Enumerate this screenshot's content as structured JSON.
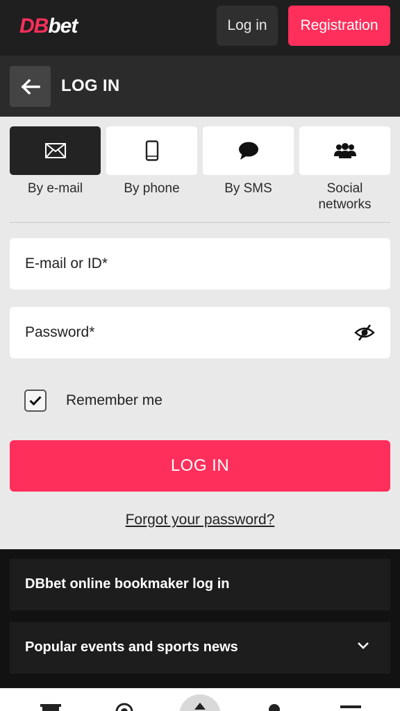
{
  "header": {
    "logo_red": "DB",
    "logo_white": "bet",
    "login_label": "Log in",
    "registration_label": "Registration",
    "brand_color": "#ff2f5b"
  },
  "titlebar": {
    "back_icon": "arrow-left-icon",
    "title": "LOG IN"
  },
  "tabs": [
    {
      "label": "By e-mail",
      "icon": "envelope-icon",
      "active": true
    },
    {
      "label": "By phone",
      "icon": "smartphone-icon",
      "active": false
    },
    {
      "label": "By SMS",
      "icon": "chat-bubble-icon",
      "active": false
    },
    {
      "label": "Social networks",
      "icon": "users-group-icon",
      "active": false
    }
  ],
  "form": {
    "email_placeholder": "E-mail or ID*",
    "password_placeholder": "Password*",
    "password_toggle_icon": "eye-slash-icon",
    "remember_label": "Remember me",
    "remember_checked": true,
    "submit_label": "LOG IN",
    "forgot_label": "Forgot your password?"
  },
  "seo": {
    "items": [
      {
        "label": "DBbet online bookmaker log in",
        "expandable": false
      },
      {
        "label": "Popular events and sports news",
        "expandable": true
      }
    ]
  },
  "bottom_nav": {
    "icons": [
      "trophy-icon",
      "casino-chip-icon",
      "center-menu-icon",
      "profile-icon",
      "menu-icon"
    ]
  }
}
